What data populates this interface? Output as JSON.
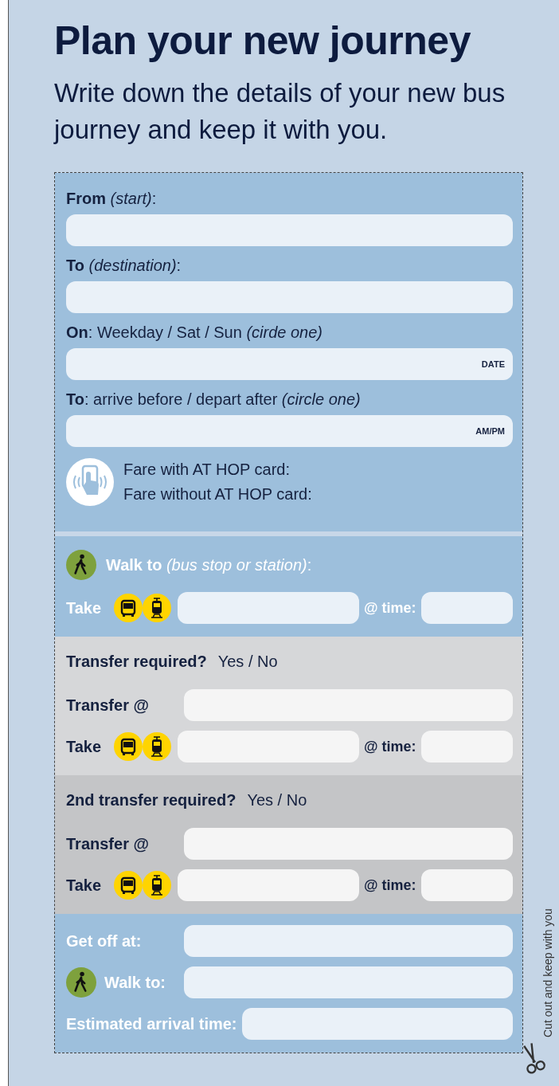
{
  "title": "Plan your new journey",
  "subtitle": "Write down the details of your new bus journey and keep it with you.",
  "sections": [
    {
      "kind": "details",
      "color": "#9dbfdc",
      "rows": [
        {
          "kind": "label",
          "text": "**From** *(start)*:"
        },
        {
          "kind": "field"
        },
        {
          "kind": "label",
          "text": "**To** *(destination)*:"
        },
        {
          "kind": "field"
        },
        {
          "kind": "label",
          "text": "**On**: Weekday / Sat / Sun *(cirde one)*"
        },
        {
          "kind": "field",
          "hint": "DATE"
        },
        {
          "kind": "label",
          "text": "**To**: arrive before / depart after *(circle one)*"
        },
        {
          "kind": "field",
          "hint": "AM/PM"
        },
        {
          "kind": "fare",
          "lines": [
            "Fare with AT HOP card:",
            "Fare without AT HOP card:"
          ]
        }
      ]
    },
    {
      "kind": "leg",
      "color": "#9dbfdc",
      "rows": [
        {
          "kind": "walk",
          "text": "**Walk to** *(bus stop or station)*:"
        },
        {
          "kind": "take",
          "label": "Take",
          "time_label": "@ time:"
        }
      ]
    },
    {
      "kind": "transfer",
      "color": "#d6d7d9",
      "rows": [
        {
          "kind": "question",
          "question": "Transfer required?",
          "answer": "Yes / No"
        },
        {
          "kind": "labeled-field",
          "label": "Transfer @"
        },
        {
          "kind": "take",
          "label": "Take",
          "time_label": "@ time:"
        }
      ]
    },
    {
      "kind": "transfer",
      "color": "#c4c5c7",
      "rows": [
        {
          "kind": "question",
          "question": "2nd transfer required?",
          "answer": "Yes / No"
        },
        {
          "kind": "labeled-field",
          "label": "Transfer @"
        },
        {
          "kind": "take",
          "label": "Take",
          "time_label": "@ time:"
        }
      ]
    },
    {
      "kind": "leg",
      "color": "#9dbfdc",
      "rows": [
        {
          "kind": "labeled-field",
          "label": "Get off at:"
        },
        {
          "kind": "walk-field",
          "label": "Walk to:"
        },
        {
          "kind": "labeled-field",
          "label": "Estimated arrival time:"
        }
      ]
    }
  ],
  "cut_note": "Cut out and keep with you"
}
